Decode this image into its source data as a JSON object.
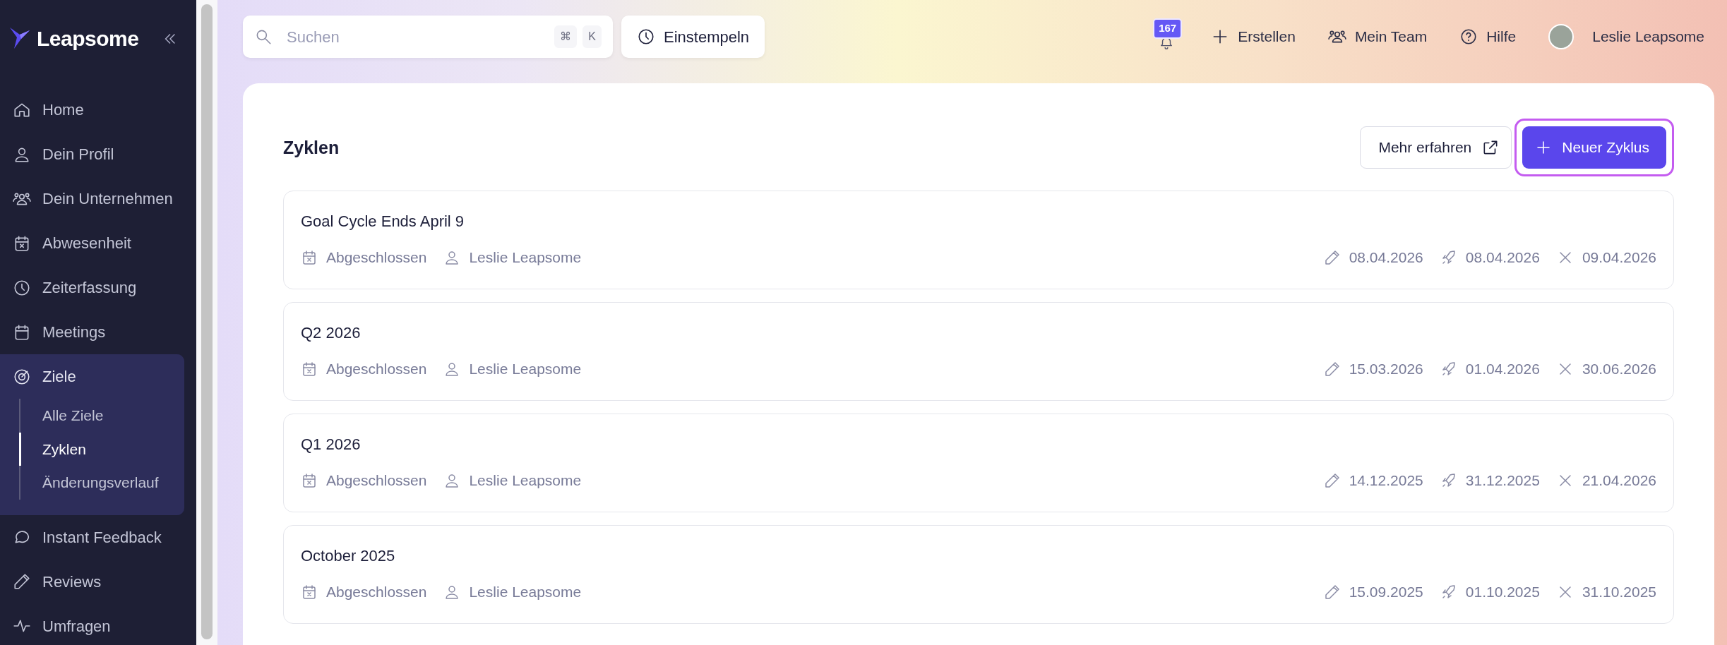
{
  "sidebar": {
    "logo": "Leapsome",
    "items": [
      {
        "label": "Home",
        "selected": false
      },
      {
        "label": "Dein Profil",
        "selected": false
      },
      {
        "label": "Dein Unternehmen",
        "selected": false
      },
      {
        "label": "Abwesenheit",
        "selected": false
      },
      {
        "label": "Zeiterfassung",
        "selected": false
      },
      {
        "label": "Meetings",
        "selected": false
      },
      {
        "label": "Ziele",
        "selected": true,
        "children": [
          {
            "label": "Alle Ziele",
            "selected": false
          },
          {
            "label": "Zyklen",
            "selected": true
          },
          {
            "label": "Änderungsverlauf",
            "selected": false
          }
        ]
      },
      {
        "label": "Instant Feedback",
        "selected": false
      },
      {
        "label": "Reviews",
        "selected": false
      },
      {
        "label": "Umfragen",
        "selected": false
      }
    ]
  },
  "topbar": {
    "search": {
      "placeholder": "Suchen",
      "keys": [
        "⌘",
        "K"
      ]
    },
    "clock_button": "Einstempeln",
    "notification_count": "167",
    "actions": [
      "Erstellen",
      "Mein Team",
      "Hilfe"
    ],
    "user": "Leslie Leapsome"
  },
  "cycles": {
    "title": "Zyklen",
    "learn_more": "Mehr erfahren",
    "new_button": "Neuer Zyklus",
    "rows": [
      {
        "name": "Goal Cycle Ends April 9",
        "status": "Abgeschlossen",
        "owner": "Leslie Leapsome",
        "edited": "08.04.2026",
        "launched": "08.04.2026",
        "ends": "09.04.2026"
      },
      {
        "name": "Q2 2026",
        "status": "Abgeschlossen",
        "owner": "Leslie Leapsome",
        "edited": "15.03.2026",
        "launched": "01.04.2026",
        "ends": "30.06.2026"
      },
      {
        "name": "Q1 2026",
        "status": "Abgeschlossen",
        "owner": "Leslie Leapsome",
        "edited": "14.12.2025",
        "launched": "31.12.2025",
        "ends": "21.04.2026"
      },
      {
        "name": "October 2025",
        "status": "Abgeschlossen",
        "owner": "Leslie Leapsome",
        "edited": "15.09.2025",
        "launched": "01.10.2025",
        "ends": "31.10.2025"
      }
    ]
  }
}
